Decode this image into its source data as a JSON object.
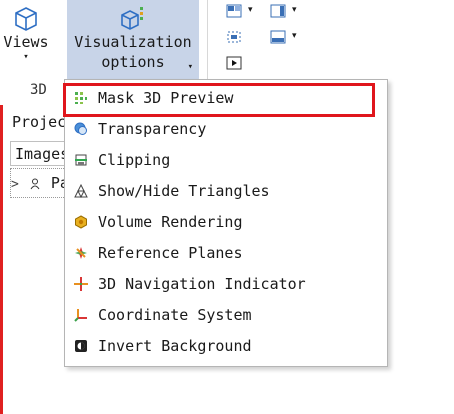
{
  "ribbon": {
    "views_label": "Views",
    "vis_label_line1": "Visualization",
    "vis_label_line2": "options",
    "caret": "▾",
    "group_label": "3D"
  },
  "panel": {
    "title": "Projec",
    "tab": "Images",
    "tree_item": "Pa",
    "chevron": ">"
  },
  "menu": {
    "items": [
      {
        "label": "Mask 3D Preview",
        "icon": "mask-preview-icon"
      },
      {
        "label": "Transparency",
        "icon": "transparency-icon"
      },
      {
        "label": "Clipping",
        "icon": "clipping-icon"
      },
      {
        "label": "Show/Hide Triangles",
        "icon": "triangles-icon"
      },
      {
        "label": "Volume Rendering",
        "icon": "volume-rendering-icon"
      },
      {
        "label": "Reference Planes",
        "icon": "reference-planes-icon"
      },
      {
        "label": "3D Navigation Indicator",
        "icon": "navigation-indicator-icon"
      },
      {
        "label": "Coordinate System",
        "icon": "coordinate-system-icon"
      },
      {
        "label": "Invert Background",
        "icon": "invert-background-icon"
      }
    ]
  },
  "colors": {
    "highlight": "#e0161c",
    "ribbon_active": "#c8d4e8",
    "accent_blue": "#2f6fc4"
  }
}
